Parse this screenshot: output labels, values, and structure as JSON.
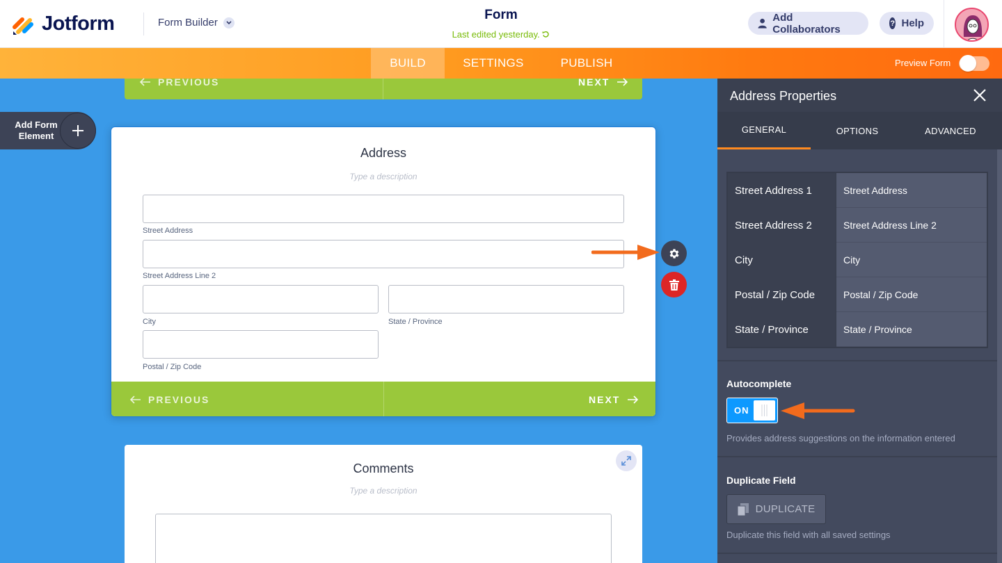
{
  "colors": {
    "canvas": "#3a9ae8",
    "navy": "#0a1551",
    "orange": "#ff7a10",
    "green": "#9ac83b",
    "panel": "#434a5e",
    "toggle_on": "#0d99ff",
    "delete": "#dc2626"
  },
  "header": {
    "brand": "Jotform",
    "builder_label": "Form Builder",
    "form_title": "Form",
    "last_edited": "Last edited yesterday.",
    "add_collaborators": "Add Collaborators",
    "help": "Help"
  },
  "nav": {
    "tabs": [
      {
        "label": "BUILD",
        "active": true
      },
      {
        "label": "SETTINGS",
        "active": false
      },
      {
        "label": "PUBLISH",
        "active": false
      }
    ],
    "preview_form": "Preview Form"
  },
  "sidebar": {
    "add_form_element": "Add Form Element"
  },
  "canvas": {
    "top_card": {
      "previous": "PREVIOUS",
      "next": "NEXT"
    },
    "address_card": {
      "title": "Address",
      "description_placeholder": "Type a description",
      "sublabels": {
        "street1": "Street Address",
        "street2": "Street Address Line 2",
        "city": "City",
        "state": "State / Province",
        "postal": "Postal / Zip Code"
      },
      "previous": "PREVIOUS",
      "next": "NEXT"
    },
    "comments_card": {
      "title": "Comments",
      "description_placeholder": "Type a description"
    }
  },
  "panel": {
    "title": "Address Properties",
    "tabs": [
      {
        "label": "GENERAL",
        "active": true
      },
      {
        "label": "OPTIONS",
        "active": false
      },
      {
        "label": "ADVANCED",
        "active": false
      }
    ],
    "sublabel_rows": [
      {
        "key": "Street Address 1",
        "value": "Street Address"
      },
      {
        "key": "Street Address 2",
        "value": "Street Address Line 2"
      },
      {
        "key": "City",
        "value": "City"
      },
      {
        "key": "Postal / Zip Code",
        "value": "Postal / Zip Code"
      },
      {
        "key": "State / Province",
        "value": "State / Province"
      }
    ],
    "autocomplete": {
      "label": "Autocomplete",
      "state": "ON",
      "help": "Provides address suggestions on the information entered"
    },
    "duplicate": {
      "label": "Duplicate Field",
      "button": "DUPLICATE",
      "help": "Duplicate this field with all saved settings"
    }
  }
}
